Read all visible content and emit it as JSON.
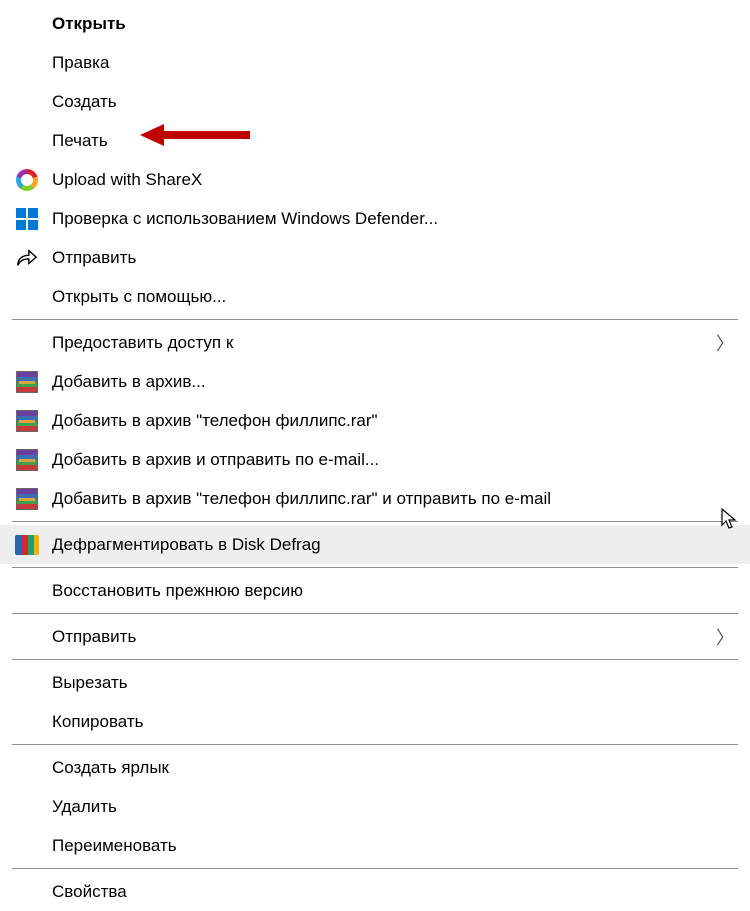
{
  "menu": {
    "open": "Открыть",
    "edit": "Правка",
    "create": "Создать",
    "print": "Печать",
    "sharex": "Upload with ShareX",
    "defender": "Проверка с использованием Windows Defender...",
    "send": "Отправить",
    "open_with": "Открыть с помощью...",
    "grant_access": "Предоставить доступ к",
    "rar_add": "Добавить в архив...",
    "rar_add_named": "Добавить в архив \"телефон филлипс.rar\"",
    "rar_add_email": "Добавить в архив и отправить по e-mail...",
    "rar_add_named_email": "Добавить в архив \"телефон филлипс.rar\" и отправить по e-mail",
    "defrag": "Дефрагментировать в Disk Defrag",
    "restore_version": "Восстановить прежнюю версию",
    "send2": "Отправить",
    "cut": "Вырезать",
    "copy": "Копировать",
    "create_shortcut": "Создать ярлык",
    "delete": "Удалить",
    "rename": "Переименовать",
    "properties": "Свойства"
  },
  "annotation": {
    "arrow_target": "print",
    "hovered_item": "defrag"
  }
}
